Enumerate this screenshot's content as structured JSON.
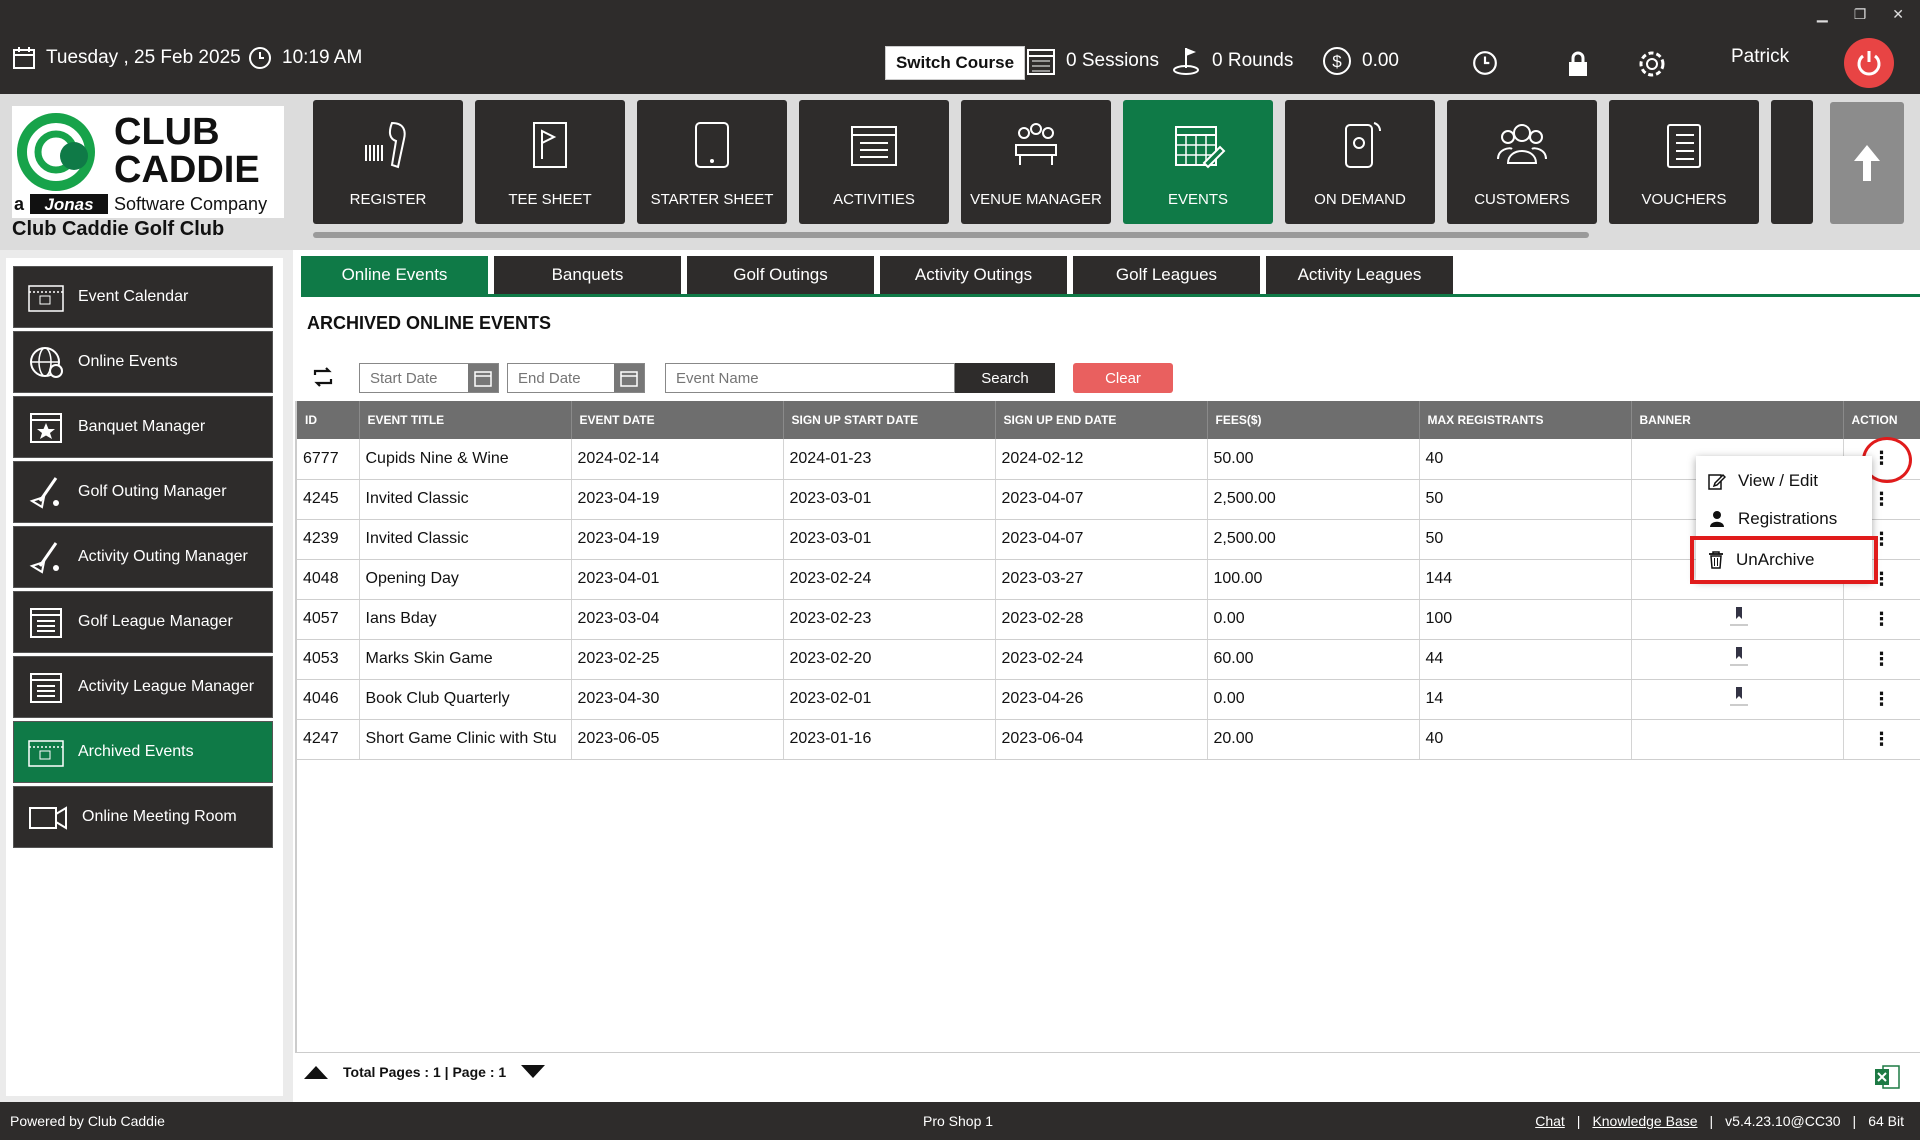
{
  "topbar": {
    "date": "Tuesday ,  25 Feb 2025",
    "time": "10:19 AM",
    "switch_course": "Switch Course",
    "sessions": "0 Sessions",
    "rounds": "0 Rounds",
    "balance": "0.00",
    "user": "Patrick"
  },
  "header": {
    "logo_line1": "CLUB",
    "logo_line2": "CADDIE",
    "logo_tagline_a": "a",
    "logo_tagline_jonas": "Jonas",
    "logo_tagline_rest": "Software Company",
    "club_name": "Club Caddie Golf Club"
  },
  "nav": [
    {
      "label": "REGISTER",
      "icon": "barcode-scanner-icon"
    },
    {
      "label": "TEE SHEET",
      "icon": "tee-sheet-icon"
    },
    {
      "label": "STARTER SHEET",
      "icon": "tablet-icon"
    },
    {
      "label": "ACTIVITIES",
      "icon": "activities-list-icon"
    },
    {
      "label": "VENUE MANAGER",
      "icon": "venue-meeting-icon"
    },
    {
      "label": "EVENTS",
      "icon": "events-calendar-icon",
      "active": true
    },
    {
      "label": "ON DEMAND",
      "icon": "mobile-phone-icon"
    },
    {
      "label": "CUSTOMERS",
      "icon": "customers-group-icon"
    },
    {
      "label": "VOUCHERS",
      "icon": "voucher-icon"
    }
  ],
  "sidebar": [
    {
      "label": "Event Calendar",
      "icon": "calendar-icon"
    },
    {
      "label": "Online Events",
      "icon": "globe-icon"
    },
    {
      "label": "Banquet Manager",
      "icon": "star-calendar-icon"
    },
    {
      "label": "Golf Outing Manager",
      "icon": "golf-club-icon"
    },
    {
      "label": "Activity Outing Manager",
      "icon": "golf-club-icon"
    },
    {
      "label": "Golf League Manager",
      "icon": "list-calendar-icon"
    },
    {
      "label": "Activity League Manager",
      "icon": "list-calendar-icon"
    },
    {
      "label": "Archived Events",
      "icon": "calendar-icon",
      "active": true
    },
    {
      "label": "Online Meeting Room",
      "icon": "video-camera-icon"
    }
  ],
  "tabs": [
    {
      "label": "Online Events",
      "active": true
    },
    {
      "label": "Banquets"
    },
    {
      "label": "Golf Outings"
    },
    {
      "label": "Activity Outings"
    },
    {
      "label": "Golf Leagues"
    },
    {
      "label": "Activity Leagues"
    }
  ],
  "section_title": "ARCHIVED ONLINE EVENTS",
  "filters": {
    "start_placeholder": "Start Date",
    "end_placeholder": "End Date",
    "name_placeholder": "Event Name",
    "search_label": "Search",
    "clear_label": "Clear"
  },
  "table": {
    "headers": [
      "ID",
      "EVENT TITLE",
      "EVENT DATE",
      "SIGN UP START DATE",
      "SIGN UP END DATE",
      "FEES($)",
      "MAX REGISTRANTS",
      "BANNER",
      "ACTION"
    ],
    "rows": [
      {
        "id": "6777",
        "title": "Cupids Nine & Wine",
        "date": "2024-02-14",
        "start": "2024-01-23",
        "end": "2024-02-12",
        "fees": "50.00",
        "max": "40",
        "banner": false
      },
      {
        "id": "4245",
        "title": "Invited Classic",
        "date": "2023-04-19",
        "start": "2023-03-01",
        "end": "2023-04-07",
        "fees": "2,500.00",
        "max": "50",
        "banner": false
      },
      {
        "id": "4239",
        "title": "Invited Classic",
        "date": "2023-04-19",
        "start": "2023-03-01",
        "end": "2023-04-07",
        "fees": "2,500.00",
        "max": "50",
        "banner": false
      },
      {
        "id": "4048",
        "title": "Opening Day",
        "date": "2023-04-01",
        "start": "2023-02-24",
        "end": "2023-03-27",
        "fees": "100.00",
        "max": "144",
        "banner": false
      },
      {
        "id": "4057",
        "title": "Ians Bday",
        "date": "2023-03-04",
        "start": "2023-02-23",
        "end": "2023-02-28",
        "fees": "0.00",
        "max": "100",
        "banner": true
      },
      {
        "id": "4053",
        "title": "Marks Skin Game",
        "date": "2023-02-25",
        "start": "2023-02-20",
        "end": "2023-02-24",
        "fees": "60.00",
        "max": "44",
        "banner": true
      },
      {
        "id": "4046",
        "title": "Book Club Quarterly",
        "date": "2023-04-30",
        "start": "2023-02-01",
        "end": "2023-04-26",
        "fees": "0.00",
        "max": "14",
        "banner": true
      },
      {
        "id": "4247",
        "title": "Short Game Clinic with Stu",
        "date": "2023-06-05",
        "start": "2023-01-16",
        "end": "2023-06-04",
        "fees": "20.00",
        "max": "40",
        "banner": false
      }
    ],
    "action_glyph": "⋮"
  },
  "dropdown": [
    {
      "label": "View / Edit",
      "icon": "edit-icon"
    },
    {
      "label": "Registrations",
      "icon": "person-icon"
    },
    {
      "label": "UnArchive",
      "icon": "trash-icon",
      "highlight": true
    }
  ],
  "pager": {
    "text": "Total Pages : 1 | Page : 1"
  },
  "footer": {
    "powered": "Powered by Club Caddie",
    "station": "Pro Shop 1",
    "chat": "Chat",
    "sep1": "|",
    "kb": "Knowledge Base",
    "sep2": "|",
    "version": "v5.4.23.10@CC30",
    "sep3": "|",
    "bits": "64 Bit"
  },
  "colors": {
    "brand_green": "#0f7a47",
    "dark": "#2e2c2b",
    "clear_red": "#e9605f",
    "highlight_red": "#e01b1b",
    "power_red": "#e84444"
  }
}
